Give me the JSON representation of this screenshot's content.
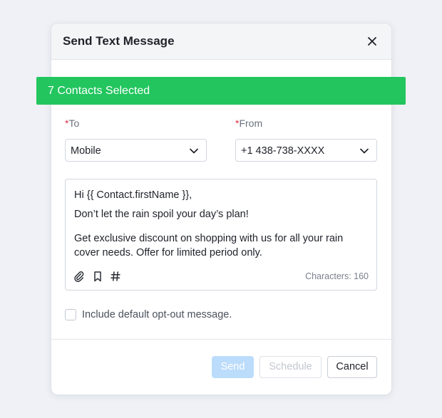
{
  "modal": {
    "title": "Send Text Message"
  },
  "banner": {
    "text": "7 Contacts Selected",
    "color": "#22c55e"
  },
  "to": {
    "required_marker": "*",
    "label": "To",
    "value": "Mobile"
  },
  "from": {
    "required_marker": "*",
    "label": "From",
    "value": "+1 438-738-XXXX"
  },
  "message": {
    "greeting": "Hi {{ Contact.firstName }},",
    "line1": "Don’t let the rain spoil your day’s plan!",
    "line2": "Get exclusive discount on shopping with us for all your rain",
    "line3": "cover needs. Offer for limited period only.",
    "char_count": "Characters: 160",
    "tools": [
      "paperclip-icon",
      "bookmark-icon",
      "hashtag-icon"
    ]
  },
  "opt_out": {
    "label": "Include default opt-out message.",
    "checked": false
  },
  "footer": {
    "send_label": "Send",
    "schedule_label": "Schedule",
    "cancel_label": "Cancel"
  },
  "colors": {
    "send_disabled_bg": "#bcdcfb",
    "required": "#e0334a",
    "page_bg": "#eff1f6"
  }
}
